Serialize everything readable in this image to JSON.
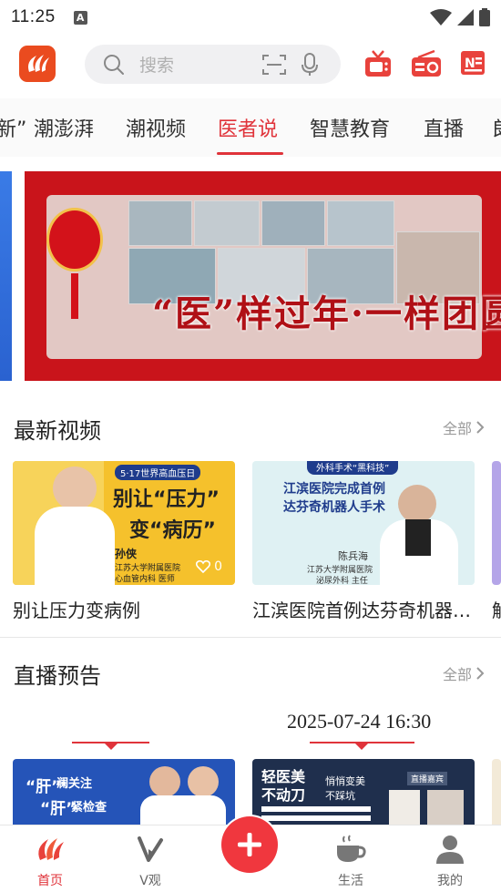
{
  "status": {
    "time": "11:25",
    "notification_badge": "A"
  },
  "header": {
    "search_placeholder": "搜索",
    "icons": [
      "app-logo",
      "search-icon",
      "scan-icon",
      "mic-icon",
      "tv-icon",
      "radio-icon",
      "news-icon"
    ],
    "accent_color": "#e0333a"
  },
  "tabs": [
    {
      "label": "新”"
    },
    {
      "label": "潮澎湃"
    },
    {
      "label": "潮视频"
    },
    {
      "label": "医者说",
      "active": true
    },
    {
      "label": "智慧教育"
    },
    {
      "label": "直播"
    },
    {
      "label": "朗"
    }
  ],
  "banner": {
    "title": "“医”样过年·一样团圆"
  },
  "latest_videos": {
    "title": "最新视频",
    "more": "全部",
    "items": [
      {
        "caption": "别让压力变病例",
        "likes": "0",
        "thumb_tag": "5·17世界高血压日",
        "thumb_line1": "别让“压力”",
        "thumb_line2": "变“病历”",
        "doctor_name": "孙侠",
        "doctor_org": "江苏大学附属医院",
        "doctor_dept": "心血管内科 医师"
      },
      {
        "caption": "江滨医院首例达芬奇机器人手术",
        "thumb_tag": "外科手术“黑科技”",
        "thumb_line1": "江滨医院完成首例",
        "thumb_line2": "达芬奇机器人手术",
        "doctor_name": "陈兵海",
        "doctor_org": "江苏大学附属医院",
        "doctor_dept": "泌尿外科 主任"
      },
      {
        "caption": "解"
      }
    ]
  },
  "live_preview": {
    "title": "直播预告",
    "more": "全部",
    "date": "2025-07-24 16:30",
    "cards": [
      {
        "text1": "“肝”",
        "text2": "澜关注",
        "text3": "“肝”",
        "text4": "紧检查"
      },
      {
        "text1": "轻医美",
        "text2": "不动刀",
        "text3": "悄悄变美",
        "text4": "不踩坑",
        "badge": "直播嘉宾"
      }
    ]
  },
  "bottom_nav": [
    {
      "label": "首页",
      "icon": "home-icon",
      "active": true
    },
    {
      "label": "V观",
      "icon": "v-icon"
    },
    {
      "label": "",
      "icon": "plus-icon"
    },
    {
      "label": "生活",
      "icon": "coffee-icon"
    },
    {
      "label": "我的",
      "icon": "user-icon"
    }
  ]
}
